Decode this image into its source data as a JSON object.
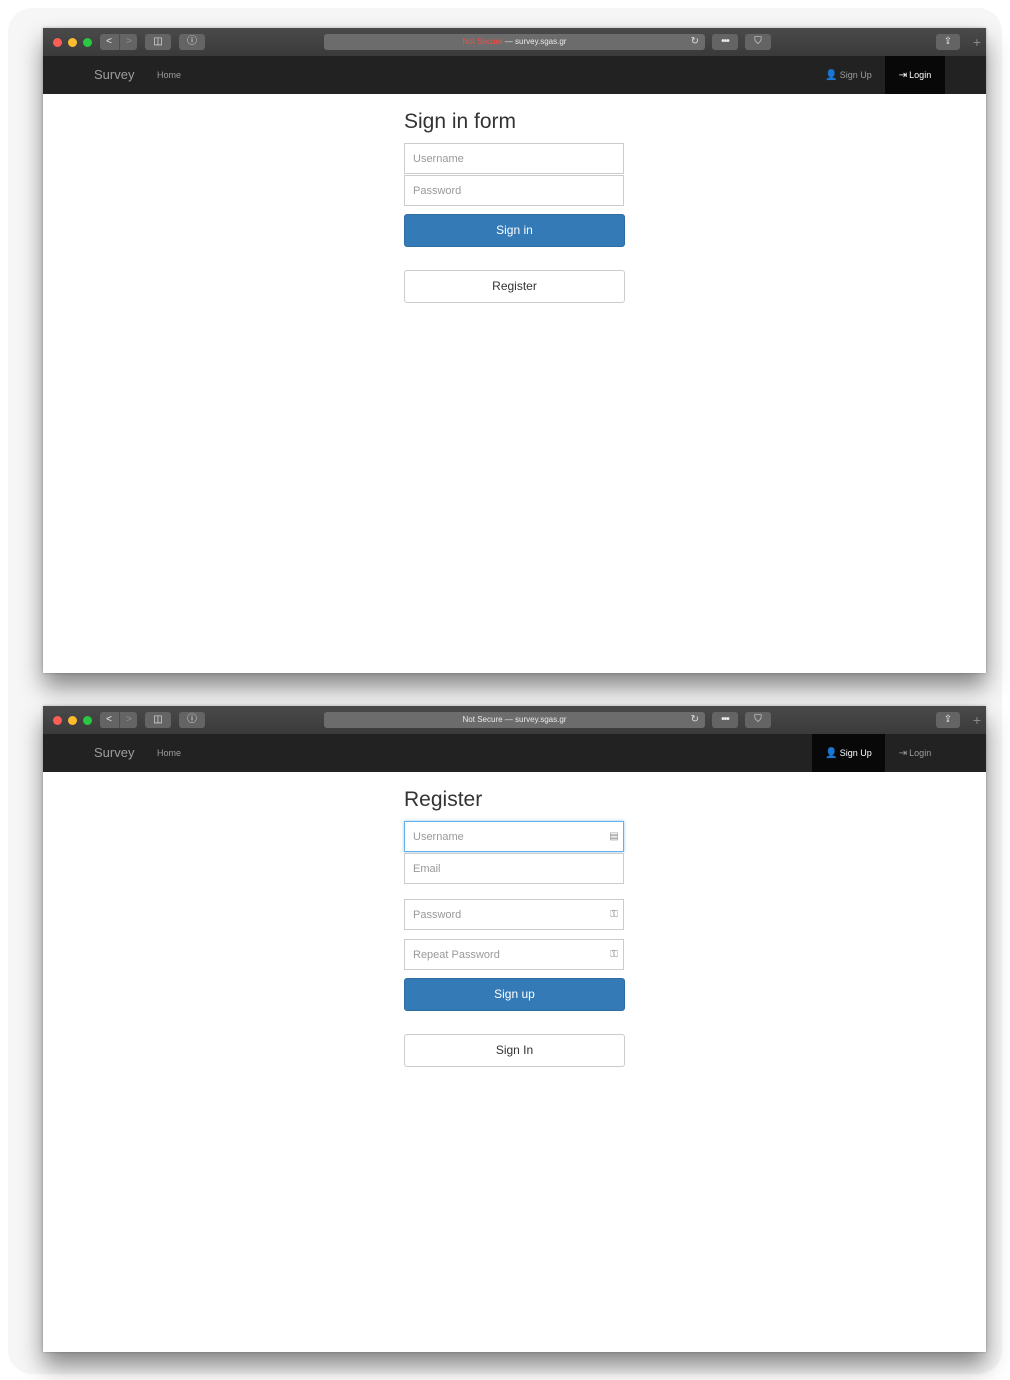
{
  "browser": {
    "address_insecure_1": "Not Secure",
    "address_insecure_2": "Not Secure",
    "address_sep": " — ",
    "address_host": "survey.sgas.gr",
    "nav_back": "<",
    "nav_forward": ">",
    "sidebar_glyph": "◫",
    "reader_glyph": "ⓘ",
    "reload_glyph": "↻",
    "more_glyph": "•••",
    "extension_glyph": "⛉",
    "share_glyph": "⇪",
    "new_tab_glyph": "+"
  },
  "navbar": {
    "brand": "Survey",
    "home": "Home",
    "signup": "Sign Up",
    "login": "Login",
    "signup_glyph": "👤",
    "login_glyph": "⇥"
  },
  "signin_page": {
    "title": "Sign in form",
    "username_placeholder": "Username",
    "password_placeholder": "Password",
    "signin_button": "Sign in",
    "register_button": "Register"
  },
  "register_page": {
    "title": "Register",
    "username_placeholder": "Username",
    "email_placeholder": "Email",
    "password_placeholder": "Password",
    "repeat_password_placeholder": "Repeat Password",
    "signup_button": "Sign up",
    "signin_button": "Sign In",
    "contact_card_glyph": "▤",
    "key_glyph": "⚿"
  },
  "colors": {
    "primary": "#337ab7",
    "navbar": "#222222",
    "navbar_active": "#080808",
    "insecure": "#ff4a3e"
  }
}
